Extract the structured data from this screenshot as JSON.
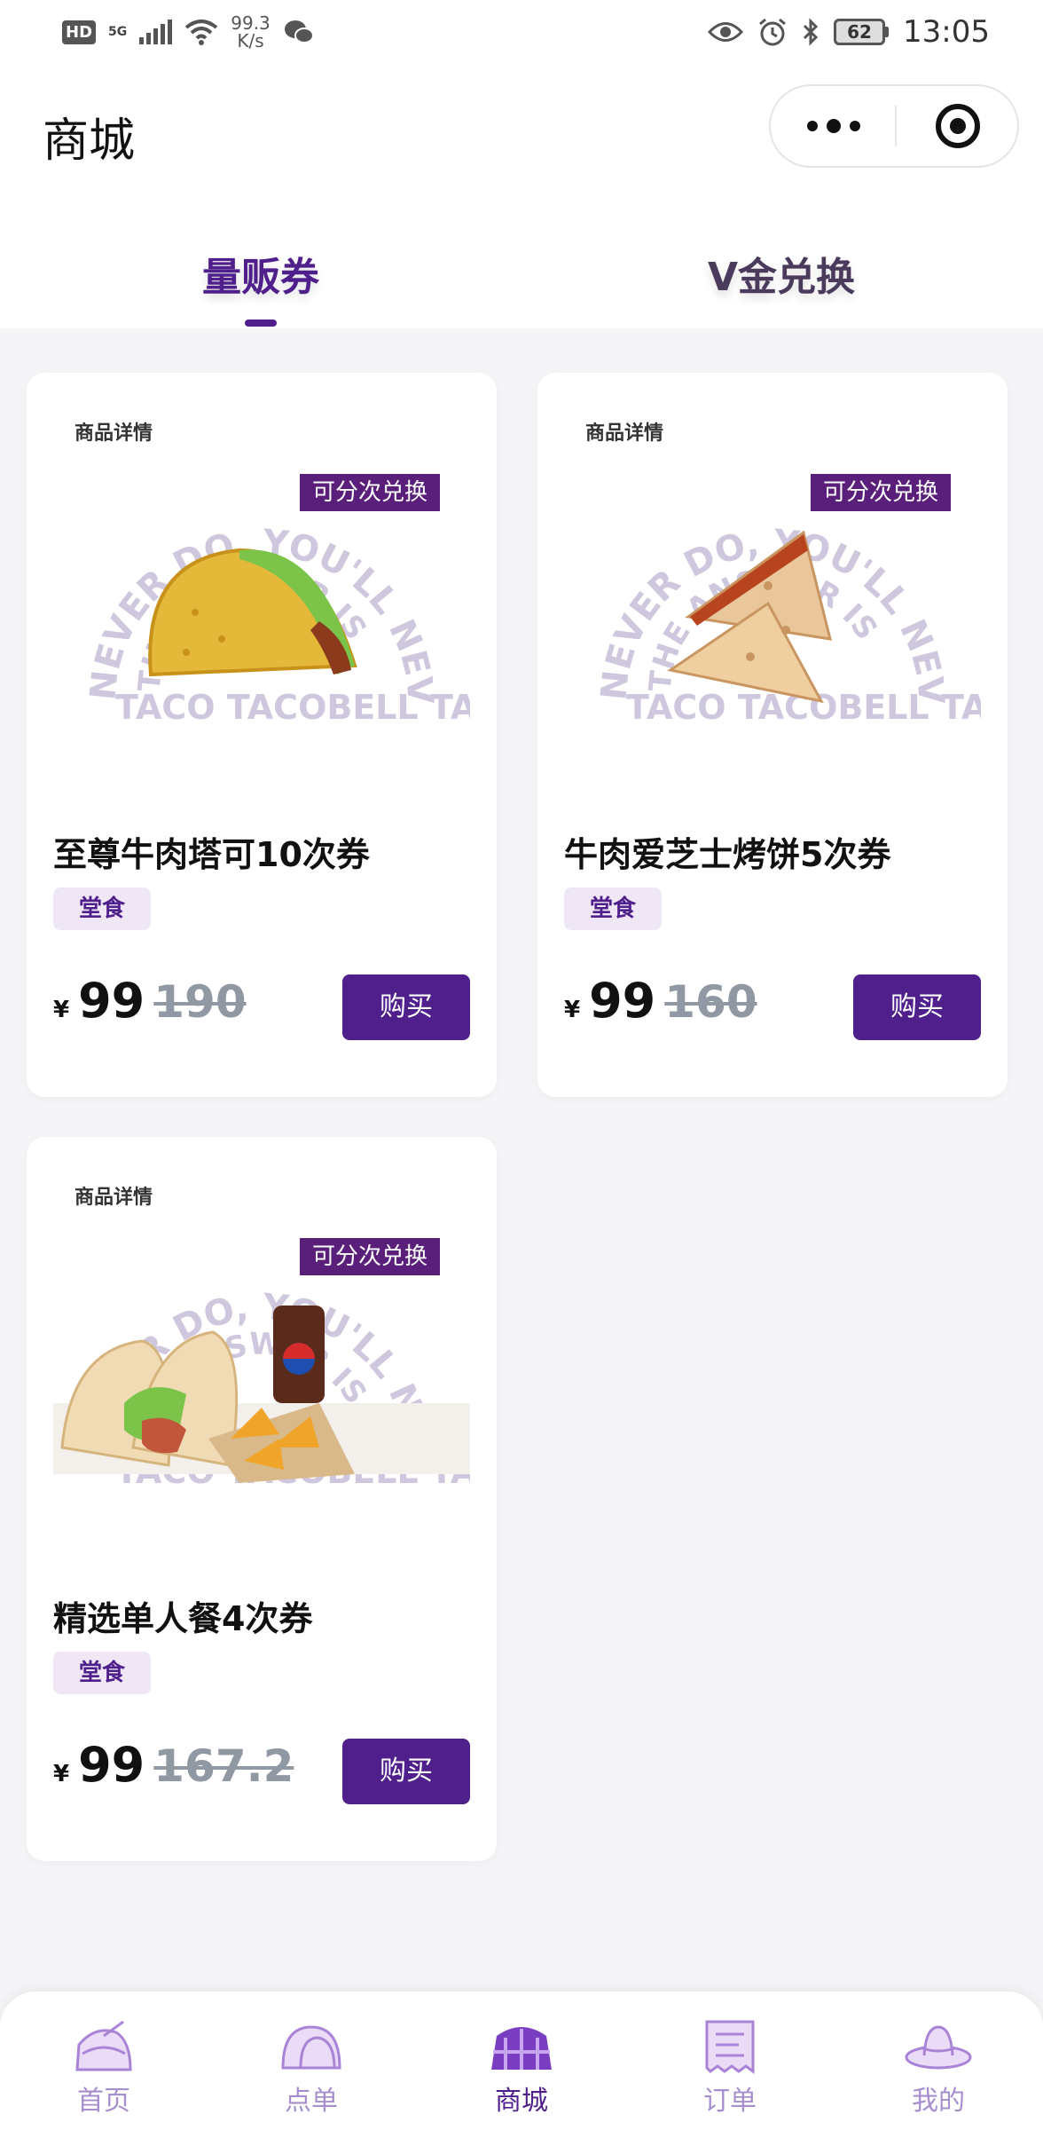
{
  "status_bar": {
    "hd": "HD",
    "network": "5G",
    "speed_value": "99.3",
    "speed_unit": "K/s",
    "battery": "62",
    "time": "13:05"
  },
  "nav": {
    "title": "商城"
  },
  "tabs": [
    {
      "label": "量贩券",
      "active": true
    },
    {
      "label": "V金兑换",
      "active": false
    }
  ],
  "cards": [
    {
      "detail_label": "商品详情",
      "tag": "可分次兑换",
      "title": "至尊牛肉塔可10次券",
      "badge": "堂食",
      "currency": "¥",
      "price": "99",
      "original_price": "190",
      "buy_label": "购买"
    },
    {
      "detail_label": "商品详情",
      "tag": "可分次兑换",
      "title": "牛肉爱芝士烤饼5次券",
      "badge": "堂食",
      "currency": "¥",
      "price": "99",
      "original_price": "160",
      "buy_label": "购买"
    },
    {
      "detail_label": "商品详情",
      "tag": "可分次兑换",
      "title": "精选单人餐4次券",
      "badge": "堂食",
      "currency": "¥",
      "price": "99",
      "original_price": "167.2",
      "buy_label": "购买"
    }
  ],
  "bottom_tabs": [
    {
      "label": "首页",
      "icon": "home-taco-icon",
      "active": false
    },
    {
      "label": "点单",
      "icon": "order-taco-icon",
      "active": false
    },
    {
      "label": "商城",
      "icon": "mall-icon",
      "active": true
    },
    {
      "label": "订单",
      "icon": "receipt-icon",
      "active": false
    },
    {
      "label": "我的",
      "icon": "sombrero-icon",
      "active": false
    }
  ],
  "colors": {
    "brand_purple": "#4f1f8c",
    "tag_purple": "#5a1f7a",
    "badge_bg": "#efe7f6",
    "strike_gray": "#9098a3",
    "page_bg": "#f5f5f8"
  }
}
